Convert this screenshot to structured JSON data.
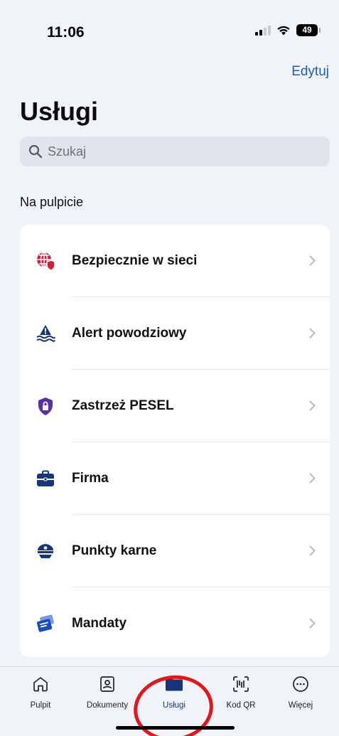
{
  "status": {
    "time": "11:06",
    "battery": "49"
  },
  "header": {
    "edit_label": "Edytuj",
    "title": "Usługi"
  },
  "search": {
    "placeholder": "Szukaj"
  },
  "section": {
    "title": "Na pulpicie"
  },
  "services": [
    {
      "label": "Bezpiecznie w sieci",
      "icon": "globe-shield-icon"
    },
    {
      "label": "Alert powodziowy",
      "icon": "flood-alert-icon"
    },
    {
      "label": "Zastrzeż PESEL",
      "icon": "lock-shield-icon"
    },
    {
      "label": "Firma",
      "icon": "briefcase-icon"
    },
    {
      "label": "Punkty karne",
      "icon": "police-cap-icon"
    },
    {
      "label": "Mandaty",
      "icon": "tickets-icon"
    }
  ],
  "tabs": [
    {
      "label": "Pulpit",
      "icon": "home-icon"
    },
    {
      "label": "Dokumenty",
      "icon": "document-person-icon"
    },
    {
      "label": "Usługi",
      "icon": "folder-icon",
      "active": true
    },
    {
      "label": "Kod QR",
      "icon": "qr-scan-icon"
    },
    {
      "label": "Więcej",
      "icon": "more-icon"
    }
  ],
  "colors": {
    "accent": "#1a5dbf",
    "active_tab": "#17357a",
    "annotation": "#e4151b",
    "background": "#f0f3f8"
  }
}
